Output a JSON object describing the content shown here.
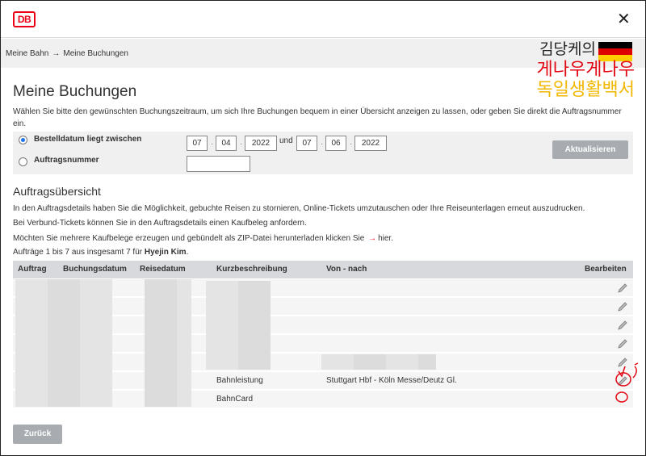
{
  "header": {
    "logo_text": "DB",
    "close_icon": "close-icon"
  },
  "breadcrumb": {
    "items": [
      "Meine Bahn",
      "Meine Buchungen"
    ],
    "separator": "→"
  },
  "watermark": {
    "line1": "김당케의",
    "line2": "게나우게나우",
    "line3": "독일생활백서"
  },
  "page": {
    "title": "Meine Buchungen",
    "intro": "Wählen Sie bitte den gewünschten Buchungszeitraum, um sich Ihre Buchungen bequem in einer Übersicht anzeigen zu lassen, oder geben Sie direkt die Auftragsnummer ein."
  },
  "filter": {
    "option_date_label": "Bestelldatum liegt zwischen",
    "option_order_label": "Auftragsnummer",
    "from": {
      "day": "07",
      "month": "04",
      "year": "2022"
    },
    "and_label": "und",
    "to": {
      "day": "07",
      "month": "06",
      "year": "2022"
    },
    "order_number": "",
    "update_button": "Aktualisieren"
  },
  "overview": {
    "title": "Auftragsübersicht",
    "line1": "In den Auftragsdetails haben Sie die Möglichkeit, gebuchte Reisen zu stornieren, Online-Tickets umzutauschen oder Ihre Reiseunterlagen erneut auszudrucken.",
    "line2": "Bei Verbund-Tickets können Sie in den Auftragsdetails einen Kaufbeleg anfordern.",
    "line3_prefix": "Möchten Sie mehrere Kaufbelege erzeugen und gebündelt als ZIP-Datei herunterladen klicken Sie",
    "line3_arrow": "→",
    "line3_link": "hier.",
    "count_prefix": "Aufträge 1 bis 7 aus insgesamt 7 für",
    "count_name": "Hyejin Kim",
    "count_suffix": "."
  },
  "table": {
    "headers": [
      "Auftrag",
      "Buchungsdatum",
      "Reisedatum",
      "Kurzbeschreibung",
      "Von - nach",
      "Bearbeiten"
    ],
    "rows": [
      {
        "kurz": "",
        "route": ""
      },
      {
        "kurz": "",
        "route": ""
      },
      {
        "kurz": "",
        "route": ""
      },
      {
        "kurz": "",
        "route": ""
      },
      {
        "kurz": "",
        "route": ""
      },
      {
        "kurz": "Bahnleistung",
        "route": "Stuttgart Hbf - Köln Messe/Deutz Gl."
      },
      {
        "kurz": "BahnCard",
        "route": ""
      }
    ],
    "edit_icon": "pencil-icon"
  },
  "back_button": "Zurück",
  "colors": {
    "db_red": "#ec0016",
    "button_grey": "#a8acb1",
    "header_grey": "#d7d9dc"
  }
}
